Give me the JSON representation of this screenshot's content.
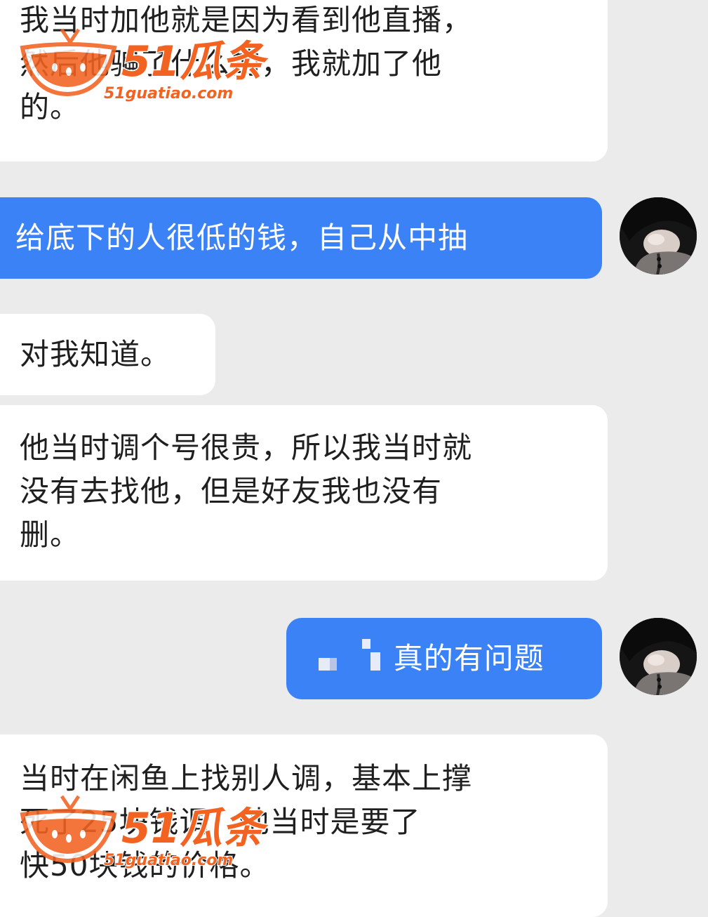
{
  "messages": [
    {
      "side": "in",
      "lines": [
        "我当时加他就是因为看到他直播，",
        "然后他骗了什么的，我就加了他",
        "的。"
      ]
    },
    {
      "side": "out",
      "text": "给底下的人很低的钱，自己从中抽"
    },
    {
      "side": "in",
      "text": "对我知道。"
    },
    {
      "side": "in",
      "lines": [
        "他当时调个号很贵，所以我当时就",
        "没有去找他，但是好友我也没有",
        "删。"
      ]
    },
    {
      "side": "out",
      "text": "真的有问题",
      "redacted_prefix": true
    },
    {
      "side": "in",
      "lines": [
        "当时在闲鱼上找别人调，基本上撑",
        "死了25块钱调，他当时是要了",
        "快50块钱的价格。"
      ]
    }
  ],
  "watermark": {
    "brand_text": "51瓜条",
    "url_text": "51guatiao.com",
    "color": "#f26322"
  },
  "colors": {
    "background": "#ebebec",
    "incoming_bubble": "#ffffff",
    "outgoing_bubble": "#3b82f6"
  }
}
